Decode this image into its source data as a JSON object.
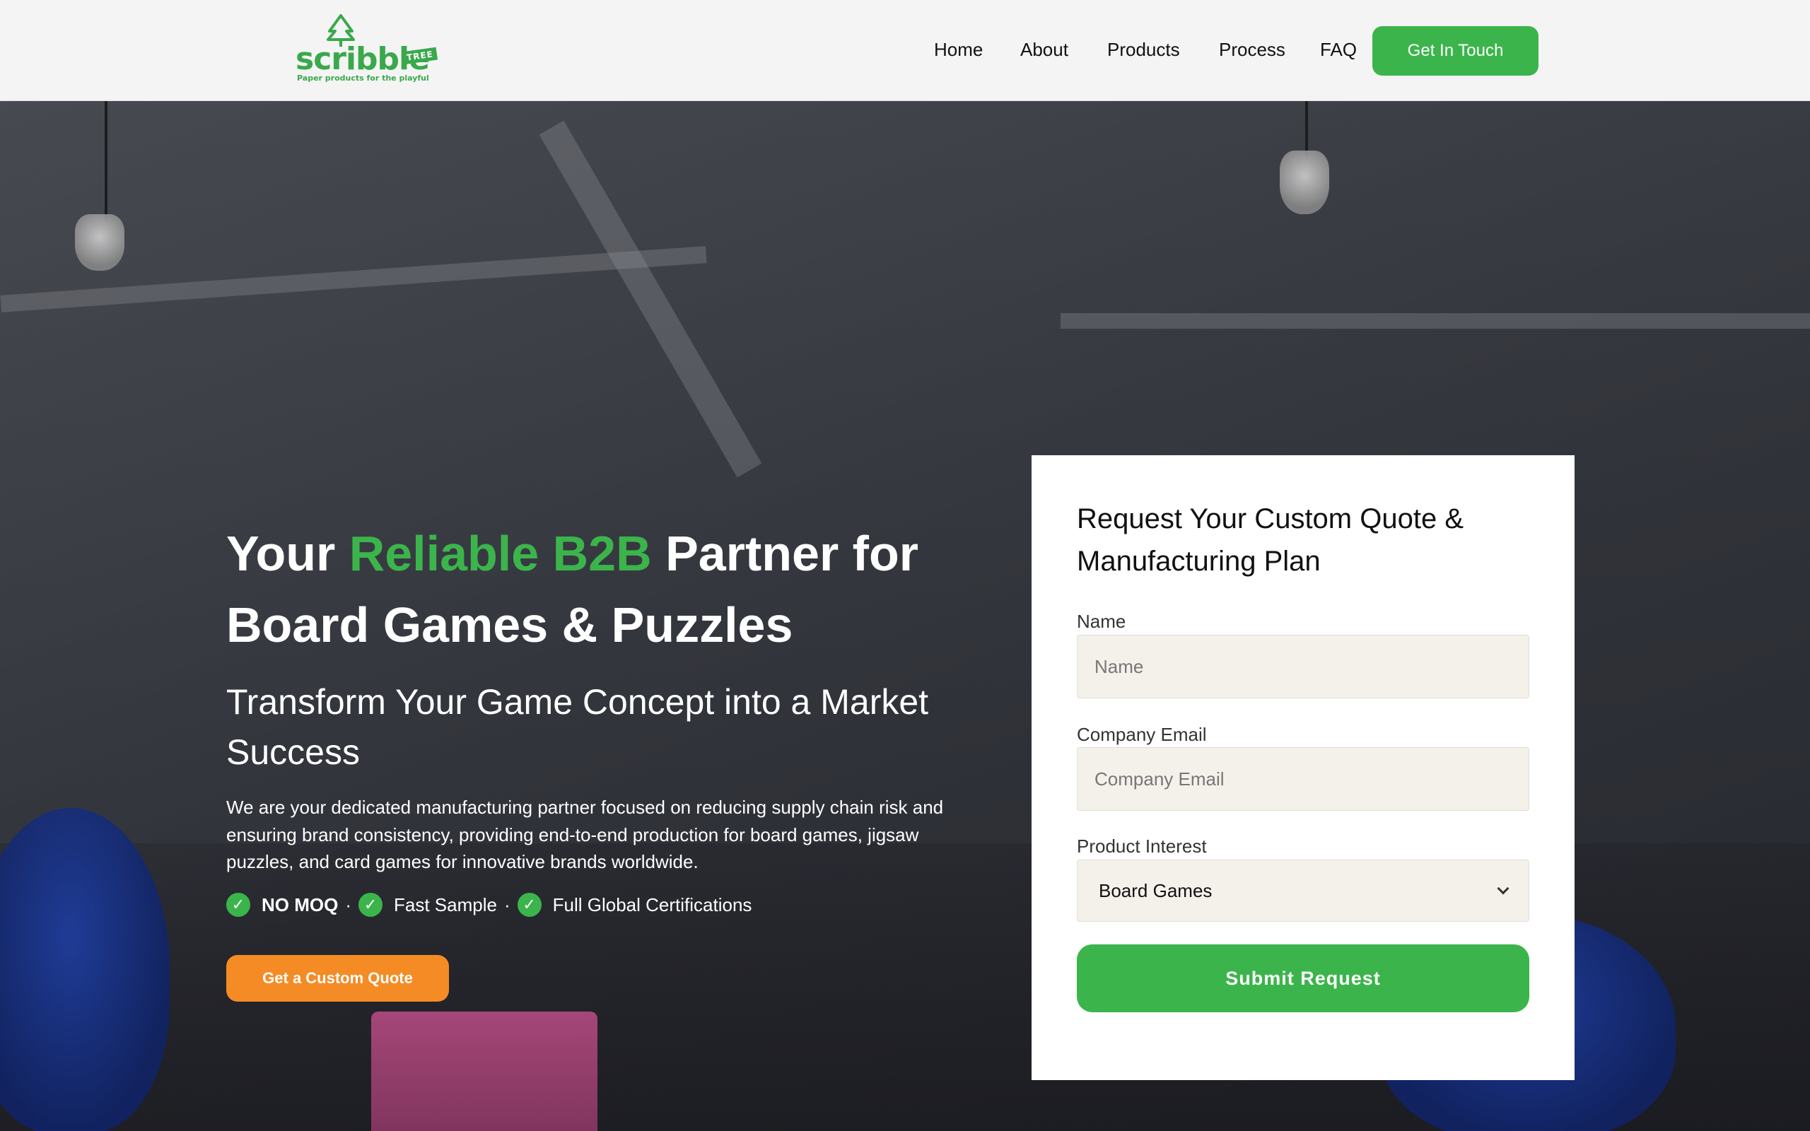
{
  "brand": {
    "wordmark": "scribble",
    "tag": "TREE",
    "tagline": "Paper products for the playful",
    "color": "#3aa84b"
  },
  "nav": {
    "items": [
      "Home",
      "About",
      "Products",
      "Process",
      "FAQ"
    ],
    "cta": "Get In Touch"
  },
  "hero": {
    "title_part1": "Your ",
    "title_accent": "Reliable B2B",
    "title_part2": " Partner for Board Games & Puzzles",
    "subtitle": "Transform Your Game Concept into a Market Success",
    "description": "We are your dedicated manufacturing partner focused on reducing supply chain risk and ensuring brand consistency, providing end-to-end production for board games, jigsaw puzzles, and card games for innovative brands worldwide.",
    "badges": [
      "NO MOQ",
      "Fast Sample",
      "Full Global Certifications"
    ],
    "separator": "·",
    "cta": "Get a Custom Quote"
  },
  "form": {
    "title": "Request Your Custom Quote & Manufacturing Plan",
    "name_label": "Name",
    "name_placeholder": "Name",
    "email_label": "Company Email",
    "email_placeholder": "Company Email",
    "interest_label": "Product Interest",
    "interest_value": "Board Games",
    "submit": "Submit Request"
  },
  "colors": {
    "accent_green": "#3bb54b",
    "accent_orange": "#f58b25"
  }
}
